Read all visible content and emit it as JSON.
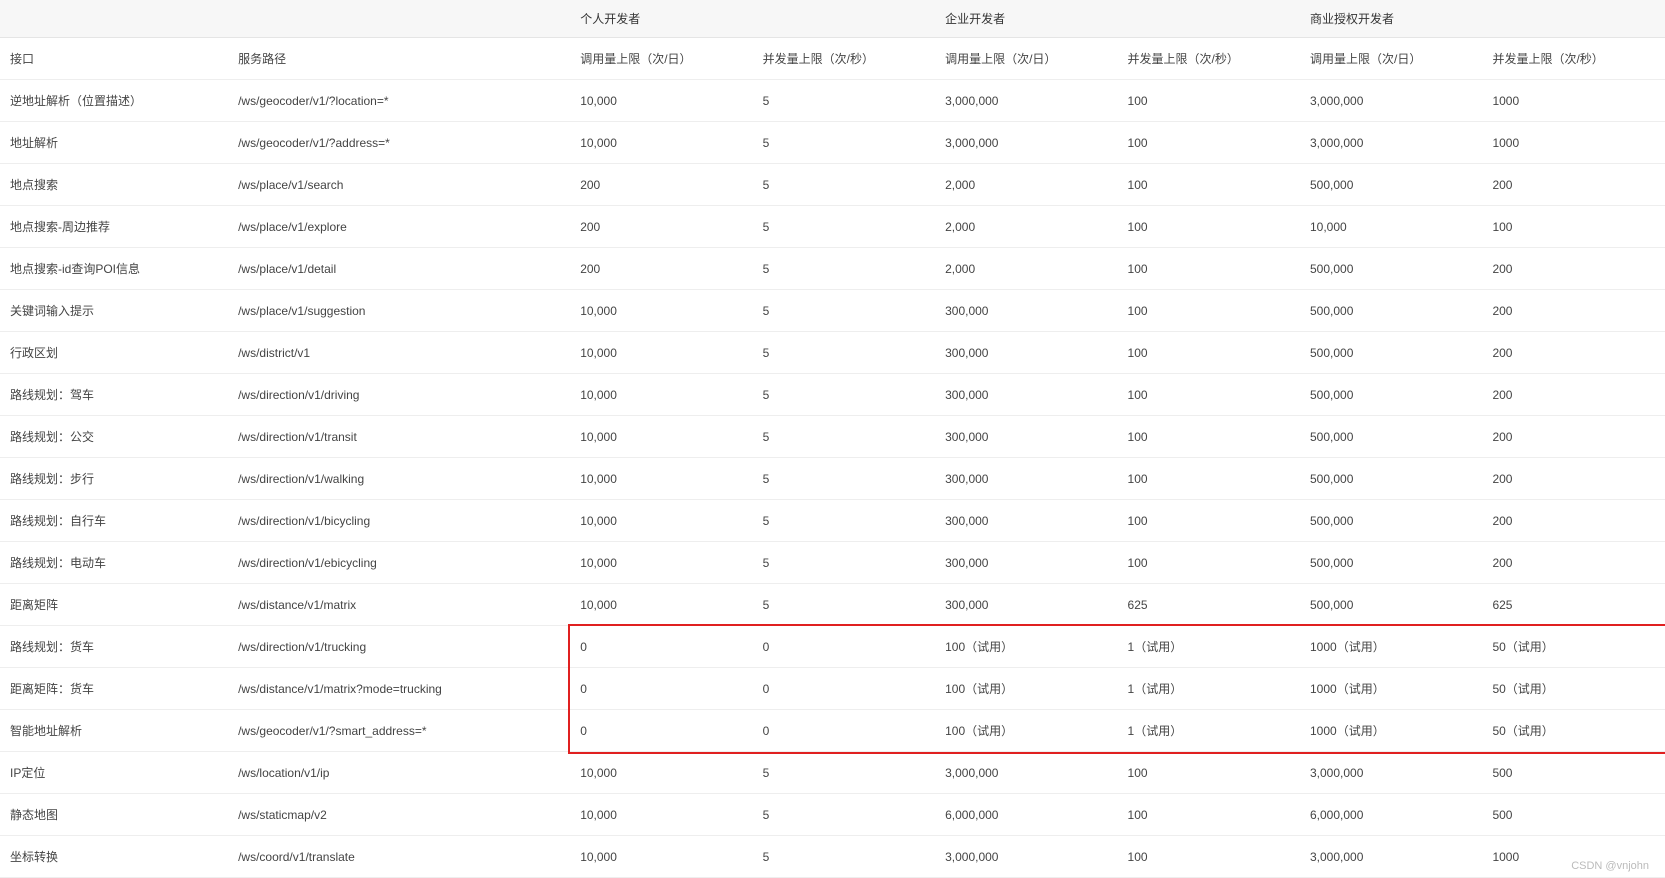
{
  "watermark": "CSDN @vnjohn",
  "groupHeaders": {
    "blank1": "",
    "blank2": "",
    "personal": "个人开发者",
    "enterprise": "企业开发者",
    "commercial": "商业授权开发者"
  },
  "subHeaders": {
    "interface": "接口",
    "servicePath": "服务路径",
    "callLimit": "调用量上限（次/日）",
    "concurrentLimit": "并发量上限（次/秒）"
  },
  "rows": [
    {
      "name": "逆地址解析（位置描述）",
      "path": "/ws/geocoder/v1/?location=*",
      "p_call": "10,000",
      "p_con": "5",
      "e_call": "3,000,000",
      "e_con": "100",
      "c_call": "3,000,000",
      "c_con": "1000"
    },
    {
      "name": "地址解析",
      "path": "/ws/geocoder/v1/?address=*",
      "p_call": "10,000",
      "p_con": "5",
      "e_call": "3,000,000",
      "e_con": "100",
      "c_call": "3,000,000",
      "c_con": "1000"
    },
    {
      "name": "地点搜索",
      "path": "/ws/place/v1/search",
      "p_call": "200",
      "p_con": "5",
      "e_call": "2,000",
      "e_con": "100",
      "c_call": "500,000",
      "c_con": "200"
    },
    {
      "name": "地点搜索-周边推荐",
      "path": "/ws/place/v1/explore",
      "p_call": "200",
      "p_con": "5",
      "e_call": "2,000",
      "e_con": "100",
      "c_call": "10,000",
      "c_con": "100"
    },
    {
      "name": "地点搜索-id查询POI信息",
      "path": "/ws/place/v1/detail",
      "p_call": "200",
      "p_con": "5",
      "e_call": "2,000",
      "e_con": "100",
      "c_call": "500,000",
      "c_con": "200"
    },
    {
      "name": "关键词输入提示",
      "path": "/ws/place/v1/suggestion",
      "p_call": "10,000",
      "p_con": "5",
      "e_call": "300,000",
      "e_con": "100",
      "c_call": "500,000",
      "c_con": "200"
    },
    {
      "name": "行政区划",
      "path": "/ws/district/v1",
      "p_call": "10,000",
      "p_con": "5",
      "e_call": "300,000",
      "e_con": "100",
      "c_call": "500,000",
      "c_con": "200"
    },
    {
      "name": "路线规划：驾车",
      "path": "/ws/direction/v1/driving",
      "p_call": "10,000",
      "p_con": "5",
      "e_call": "300,000",
      "e_con": "100",
      "c_call": "500,000",
      "c_con": "200"
    },
    {
      "name": "路线规划：公交",
      "path": "/ws/direction/v1/transit",
      "p_call": "10,000",
      "p_con": "5",
      "e_call": "300,000",
      "e_con": "100",
      "c_call": "500,000",
      "c_con": "200"
    },
    {
      "name": "路线规划：步行",
      "path": "/ws/direction/v1/walking",
      "p_call": "10,000",
      "p_con": "5",
      "e_call": "300,000",
      "e_con": "100",
      "c_call": "500,000",
      "c_con": "200"
    },
    {
      "name": "路线规划：自行车",
      "path": "/ws/direction/v1/bicycling",
      "p_call": "10,000",
      "p_con": "5",
      "e_call": "300,000",
      "e_con": "100",
      "c_call": "500,000",
      "c_con": "200"
    },
    {
      "name": "路线规划：电动车",
      "path": "/ws/direction/v1/ebicycling",
      "p_call": "10,000",
      "p_con": "5",
      "e_call": "300,000",
      "e_con": "100",
      "c_call": "500,000",
      "c_con": "200"
    },
    {
      "name": "距离矩阵",
      "path": "/ws/distance/v1/matrix",
      "p_call": "10,000",
      "p_con": "5",
      "e_call": "300,000",
      "e_con": "625",
      "c_call": "500,000",
      "c_con": "625"
    },
    {
      "name": "路线规划：货车",
      "path": "/ws/direction/v1/trucking",
      "p_call": "0",
      "p_con": "0",
      "e_call": "100（试用）",
      "e_con": "1（试用）",
      "c_call": "1000（试用）",
      "c_con": "50（试用）"
    },
    {
      "name": "距离矩阵：货车",
      "path": "/ws/distance/v1/matrix?mode=trucking",
      "p_call": "0",
      "p_con": "0",
      "e_call": "100（试用）",
      "e_con": "1（试用）",
      "c_call": "1000（试用）",
      "c_con": "50（试用）"
    },
    {
      "name": "智能地址解析",
      "path": "/ws/geocoder/v1/?smart_address=*",
      "p_call": "0",
      "p_con": "0",
      "e_call": "100（试用）",
      "e_con": "1（试用）",
      "c_call": "1000（试用）",
      "c_con": "50（试用）"
    },
    {
      "name": "IP定位",
      "path": "/ws/location/v1/ip",
      "p_call": "10,000",
      "p_con": "5",
      "e_call": "3,000,000",
      "e_con": "100",
      "c_call": "3,000,000",
      "c_con": "500"
    },
    {
      "name": "静态地图",
      "path": "/ws/staticmap/v2",
      "p_call": "10,000",
      "p_con": "5",
      "e_call": "6,000,000",
      "e_con": "100",
      "c_call": "6,000,000",
      "c_con": "500"
    },
    {
      "name": "坐标转换",
      "path": "/ws/coord/v1/translate",
      "p_call": "10,000",
      "p_con": "5",
      "e_call": "3,000,000",
      "e_con": "100",
      "c_call": "3,000,000",
      "c_con": "1000"
    }
  ],
  "highlightRows": {
    "start": 13,
    "end": 15
  }
}
